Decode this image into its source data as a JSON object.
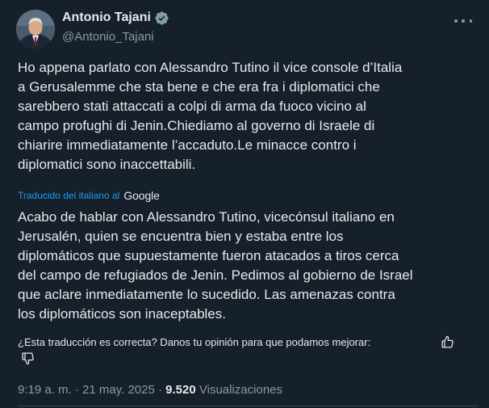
{
  "author": {
    "name": "Antonio Tajani",
    "handle": "@Antonio_Tajani",
    "verified": true
  },
  "icons": {
    "verified": "verified-badge-icon",
    "more": "more-options-icon",
    "thumb_up": "thumb-up-icon",
    "thumb_down": "thumb-down-icon"
  },
  "colors": {
    "background": "#15202b",
    "link": "#1d9bf0",
    "secondary_text": "#8b98a5",
    "primary_text": "#e7e9ea"
  },
  "post": {
    "original_text": "Ho appena parlato con Alessandro Tutino il vice console d’Italia\na Gerusalemme che sta bene e che era fra i diplomatici che\nsarebbero stati attaccati a colpi di arma da fuoco vicino al\ncampo profughi di Jenin.Chiediamo al governo di Israele di\nchiarire immediatamente l’accaduto.Le minacce contro i\ndiplomatici sono inaccettabili.",
    "translated_by_label": "Traducido del italiano al",
    "translator_brand": "Google",
    "translated_text": "Acabo de hablar con Alessandro Tutino, vicecónsul italiano en\nJerusalén, quien se encuentra bien y estaba entre los\ndiplomáticos que supuestamente fueron atacados a tiros cerca\ndel campo de refugiados de Jenin. Pedimos al gobierno de Israel\nque aclare inmediatamente lo sucedido. Las amenazas contra\nlos diplomáticos son inaceptables.",
    "feedback_prompt": "¿Esta traducción es correcta? Danos tu opinión para que podamos mejorar:",
    "time": "9:19 a. m.",
    "separator": "·",
    "date": "21 may. 2025",
    "views_count": "9.520",
    "views_label": "Visualizaciones"
  }
}
